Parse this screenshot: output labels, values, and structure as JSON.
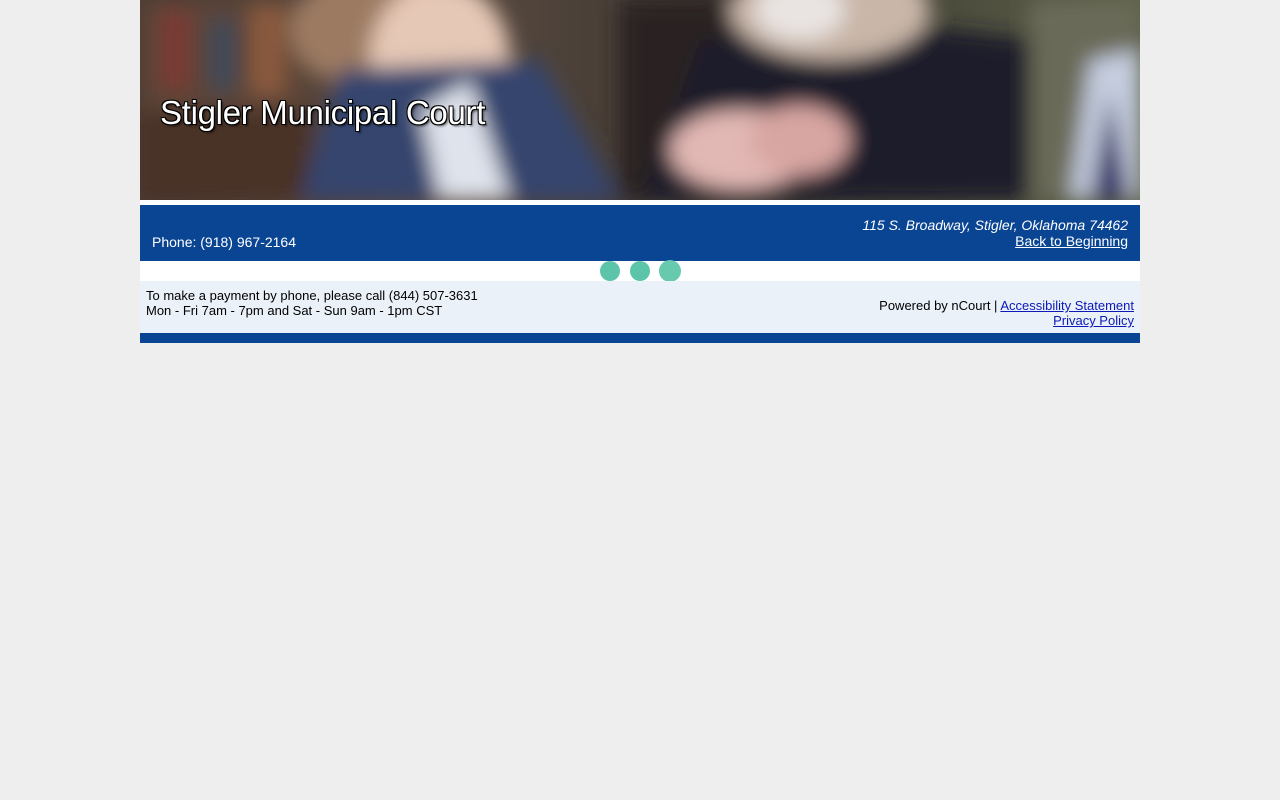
{
  "header": {
    "title": "Stigler Municipal Court"
  },
  "info_bar": {
    "phone": "Phone: (918) 967-2164",
    "address": "115 S. Broadway, Stigler, Oklahoma 74462",
    "back_link": "Back to Beginning"
  },
  "loader": {
    "dot_color": "#5cc4a8"
  },
  "footer": {
    "payment_line": "To make a payment by phone, please call (844) 507-3631",
    "hours_line": "Mon - Fri 7am - 7pm and Sat - Sun 9am - 1pm CST",
    "powered_by": "Powered by nCourt | ",
    "accessibility_link": "Accessibility Statement",
    "privacy_link": "Privacy Policy"
  },
  "colors": {
    "brand_blue": "#0a4594",
    "footer_bg": "#ebf1f9",
    "page_bg": "#eeeeee",
    "link": "#0b19b8"
  }
}
